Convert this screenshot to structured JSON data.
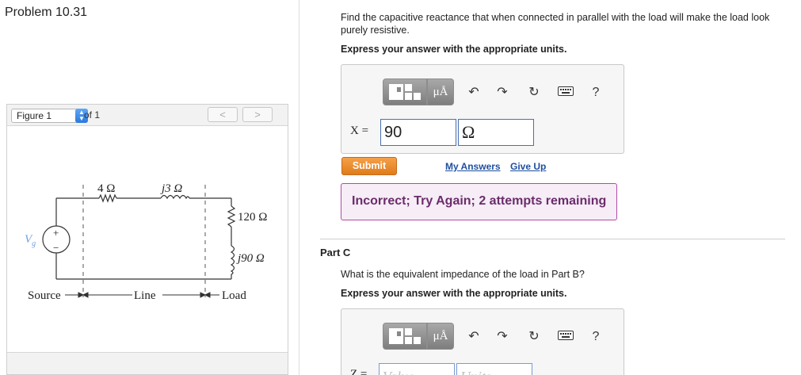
{
  "problem_title": "Problem 10.31",
  "figure_nav": {
    "select_label": "Figure 1",
    "of_label": "of 1",
    "prev_label": "<",
    "next_label": ">"
  },
  "circuit": {
    "source_label": "Vg",
    "source_sub": "g",
    "plus": "+",
    "minus": "−",
    "r_line": "4 Ω",
    "x_line": "j3 Ω",
    "r_load": "120 Ω",
    "x_load": "j90 Ω",
    "label_source": "Source",
    "label_line": "Line",
    "label_load": "Load"
  },
  "part_b": {
    "question": "Find the capacitive reactance that when connected in parallel with the load will make the load look purely resistive.",
    "express": "Express your answer with the appropriate units.",
    "toolbar": {
      "units_label": "μÅ",
      "help_label": "?"
    },
    "var_label": "X =",
    "value": "90",
    "units": "Ω",
    "submit_label": "Submit",
    "my_answers_label": "My Answers",
    "give_up_label": "Give Up",
    "feedback": "Incorrect; Try Again; 2 attempts remaining"
  },
  "part_c": {
    "label": "Part C",
    "question": "What is the equivalent impedance of the load in Part B?",
    "express": "Express your answer with the appropriate units.",
    "toolbar": {
      "units_label": "μÅ",
      "help_label": "?"
    },
    "var_label": "Z =",
    "value_placeholder": "Value",
    "units_placeholder": "Units"
  }
}
